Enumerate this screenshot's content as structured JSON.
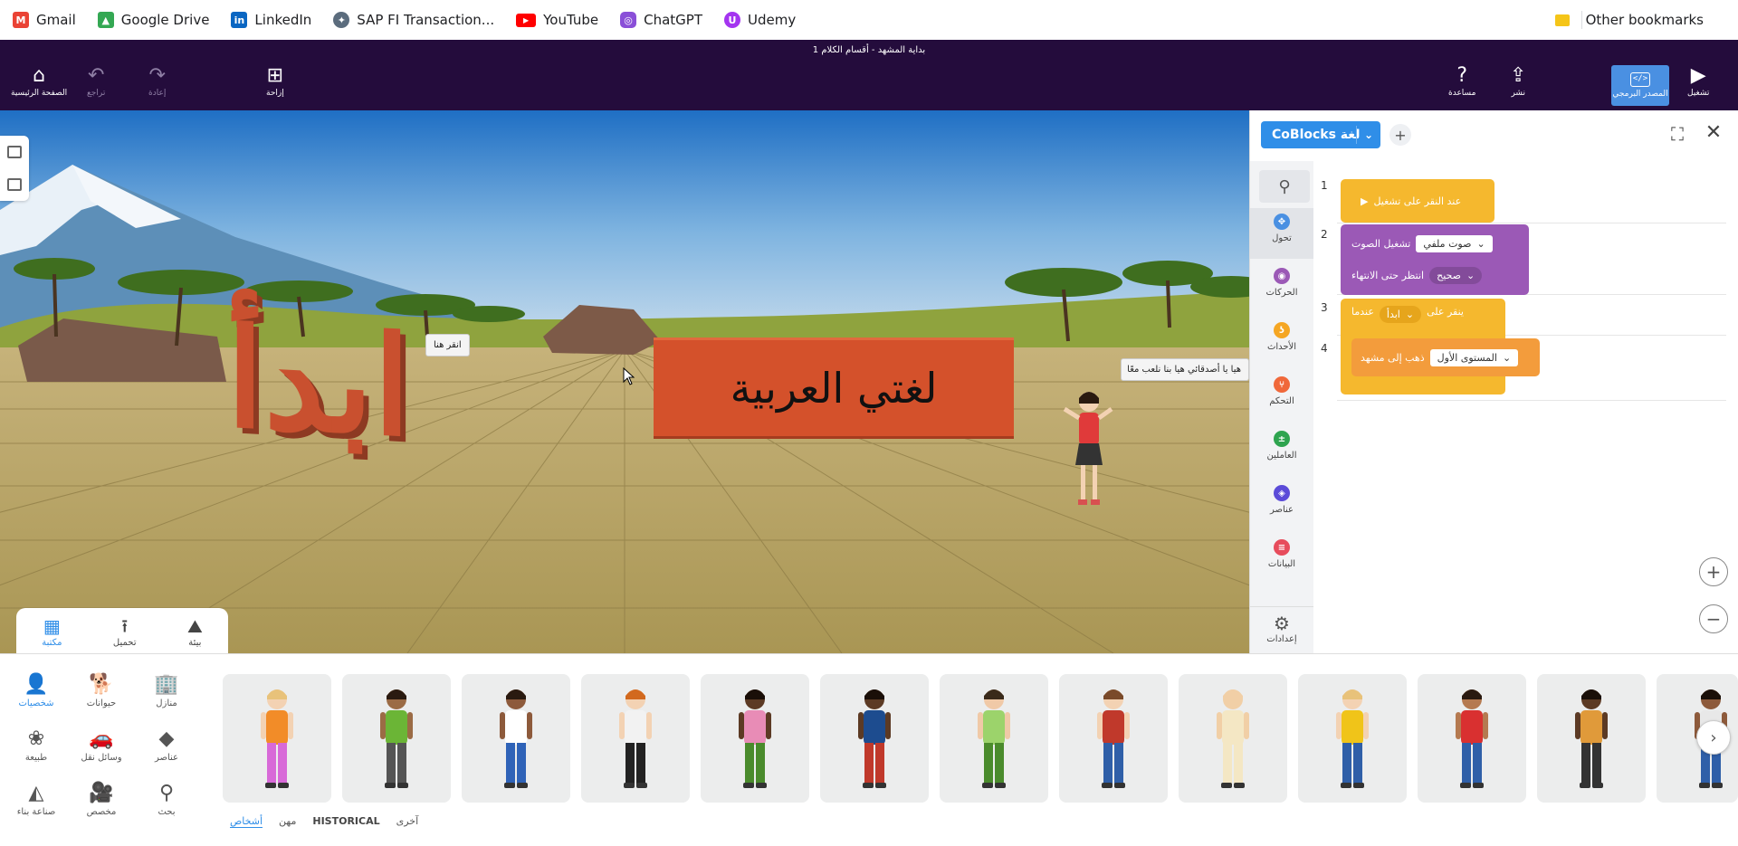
{
  "bookmarks": {
    "items": [
      {
        "label": "Gmail",
        "icon": "gmail-icon",
        "color": "#ea4335"
      },
      {
        "label": "Google Drive",
        "icon": "google-drive-icon",
        "color": "#34a853"
      },
      {
        "label": "LinkedIn",
        "icon": "linkedin-icon",
        "color": "#0a66c2"
      },
      {
        "label": "SAP FI Transaction...",
        "icon": "sap-icon",
        "color": "#5b6c7d"
      },
      {
        "label": "YouTube",
        "icon": "youtube-icon",
        "color": "#ff0000"
      },
      {
        "label": "ChatGPT",
        "icon": "chatgpt-icon",
        "color": "#8a4fd8"
      },
      {
        "label": "Udemy",
        "icon": "udemy-icon",
        "color": "#a435f0"
      }
    ],
    "other": "Other bookmarks"
  },
  "topbar": {
    "scene_title": "بداية المشهد - أقسام الكلام 1",
    "home": "الصفحة الرئيسية",
    "undo": "تراجع",
    "redo": "إعادة",
    "add": "إزاحة",
    "help": "مساعدة",
    "share": "نشر",
    "code": "المصدر البرمجي",
    "play": "تشغيل"
  },
  "scene": {
    "tooltip_click": "انقر هنا",
    "speech": "هيا يا أصدقائي هيا بنا نلعب معًا",
    "abda": "ابدأ",
    "board_text": "لغتي العربية"
  },
  "panel": {
    "language": "CoBlocks لغة",
    "categories": [
      {
        "label": "تحول",
        "color": "#4a90e2",
        "icon": "move-icon"
      },
      {
        "label": "الحركات",
        "color": "#9b59b6",
        "icon": "eye-icon"
      },
      {
        "label": "الأحداث",
        "color": "#f5a623",
        "icon": "events-icon"
      },
      {
        "label": "التحكم",
        "color": "#f0683a",
        "icon": "control-icon"
      },
      {
        "label": "العاملين",
        "color": "#2ea44f",
        "icon": "operators-icon"
      },
      {
        "label": "عناصر",
        "color": "#5b4bd8",
        "icon": "items-icon"
      },
      {
        "label": "البيانات",
        "color": "#e74c5c",
        "icon": "data-icon"
      }
    ],
    "settings": "إعدادات",
    "line_numbers": [
      "1",
      "2",
      "3",
      "4"
    ],
    "blocks": {
      "when_play": "عند النقر على تشغيل",
      "play_sound": "تشغيل الصوت",
      "sound_value": "صوت ملفي",
      "wait_label": "انتظر حتى الانتهاء",
      "wait_value": "صحيح",
      "when_clicked": "ينقر على",
      "object_value": "ابدأ",
      "when_word": "عندما",
      "go_scene": "ذهب إلى مشهد",
      "scene_value": "المستوى الأول"
    }
  },
  "library": {
    "tabs": [
      {
        "label": "مكتبة",
        "icon": "library-icon"
      },
      {
        "label": "تحميل",
        "icon": "upload-icon"
      },
      {
        "label": "بيئة",
        "icon": "environment-icon"
      }
    ],
    "categories": [
      {
        "label": "شخصيات",
        "icon": "person-icon"
      },
      {
        "label": "حيوانات",
        "icon": "animal-icon"
      },
      {
        "label": "منازل",
        "icon": "building-icon"
      },
      {
        "label": "طبيعة",
        "icon": "nature-icon"
      },
      {
        "label": "وسائل نقل",
        "icon": "car-icon"
      },
      {
        "label": "عناصر",
        "icon": "gem-icon"
      },
      {
        "label": "صناعة بناء",
        "icon": "build-icon"
      },
      {
        "label": "مخصص",
        "icon": "camera-icon"
      },
      {
        "label": "بحث",
        "icon": "search-icon"
      }
    ],
    "sub_tabs": [
      "أشخاص",
      "مهن",
      "HISTORICAL",
      "آخرى"
    ],
    "characters": [
      {
        "shirt": "#f28c28",
        "pants": "#d86ad8",
        "skin": "#f3d2b3",
        "hair": "#e8c27a"
      },
      {
        "shirt": "#6bb536",
        "pants": "#555555",
        "skin": "#9b6b45",
        "hair": "#2a1a10"
      },
      {
        "shirt": "#ffffff",
        "pants": "#2f63b8",
        "skin": "#8d5a3b",
        "hair": "#2a1a10"
      },
      {
        "shirt": "#f2f2f2",
        "pants": "#222222",
        "skin": "#f3d2b3",
        "hair": "#d2691e"
      },
      {
        "shirt": "#e88cb6",
        "pants": "#4a8b2c",
        "skin": "#5c3a24",
        "hair": "#1a0f08"
      },
      {
        "shirt": "#1d4c8f",
        "pants": "#c0392b",
        "skin": "#5c3a24",
        "hair": "#1a0f08"
      },
      {
        "shirt": "#9cd36b",
        "pants": "#4a8b2c",
        "skin": "#f0c9a7",
        "hair": "#3a2a1a"
      },
      {
        "shirt": "#c0392b",
        "pants": "#2f5fa8",
        "skin": "#f3d2b3",
        "hair": "#7a4a2a"
      },
      {
        "shirt": "#f4e7c4",
        "pants": "#f4e7c4",
        "skin": "#f1cfa6",
        "hair": "#f1cfa6"
      },
      {
        "shirt": "#f0c419",
        "pants": "#2f5fa8",
        "skin": "#f3d2b3",
        "hair": "#e8c27a"
      },
      {
        "shirt": "#d93030",
        "pants": "#2f5fa8",
        "skin": "#b57a50",
        "hair": "#2a1a10"
      },
      {
        "shirt": "#e09a3a",
        "pants": "#333333",
        "skin": "#5c3a24",
        "hair": "#1a0f08"
      },
      {
        "shirt": "#e8e8e8",
        "pants": "#2f5fa8",
        "skin": "#8d5a3b",
        "hair": "#1a0f08"
      }
    ]
  }
}
